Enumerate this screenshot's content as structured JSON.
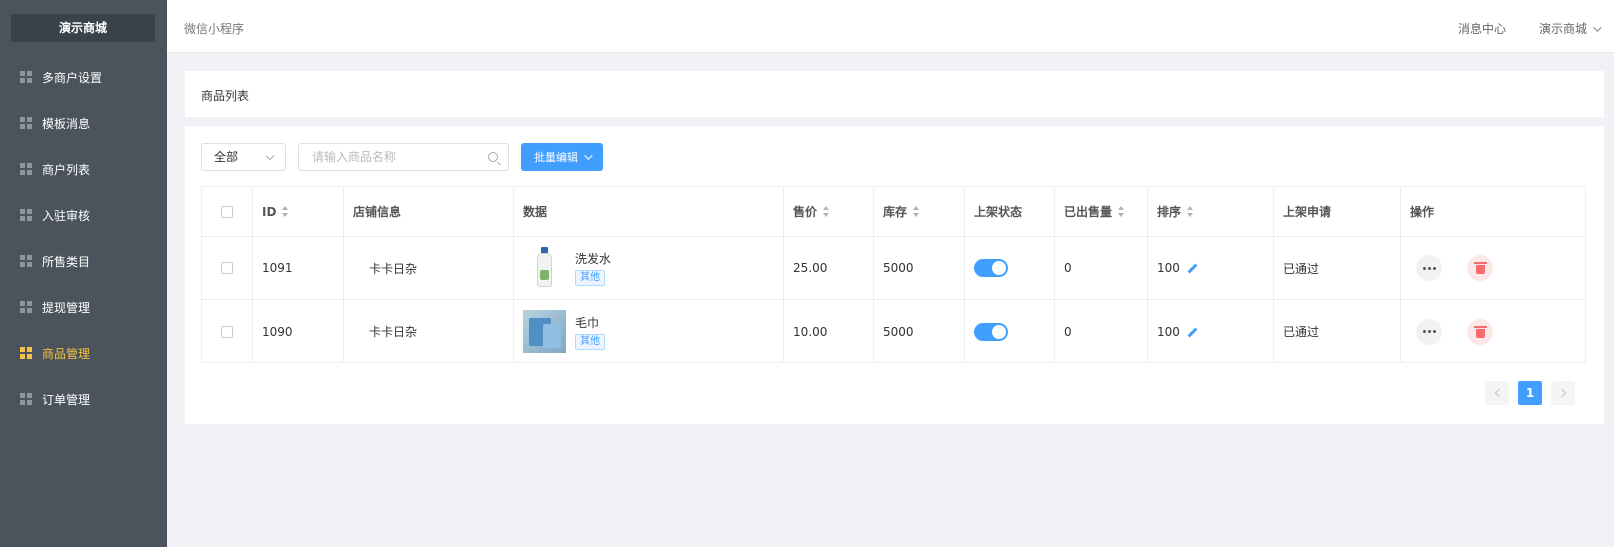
{
  "brand": "演示商城",
  "sidebar": {
    "items": [
      {
        "label": "多商户设置",
        "active": false
      },
      {
        "label": "模板消息",
        "active": false
      },
      {
        "label": "商户列表",
        "active": false
      },
      {
        "label": "入驻审核",
        "active": false
      },
      {
        "label": "所售类目",
        "active": false
      },
      {
        "label": "提现管理",
        "active": false
      },
      {
        "label": "商品管理",
        "active": true
      },
      {
        "label": "订单管理",
        "active": false
      }
    ],
    "active_color": "#f5c242"
  },
  "header": {
    "breadcrumb": "微信小程序",
    "message_center": "消息中心",
    "user": "演示商城"
  },
  "page_title": "商品列表",
  "filters": {
    "status_select": "全部",
    "search_placeholder": "请输入商品名称",
    "batch_edit": "批量编辑"
  },
  "table": {
    "columns": [
      "ID",
      "店铺信息",
      "数据",
      "售价",
      "库存",
      "上架状态",
      "已出售量",
      "排序",
      "上架申请",
      "操作"
    ],
    "rows": [
      {
        "id": "1091",
        "shop": "卡卡日杂",
        "product": "洗发水",
        "tag": "其他",
        "price": "25.00",
        "stock": "5000",
        "listed": true,
        "sold": "0",
        "sort": "100",
        "apply": "已通过",
        "thumb_icon": "shampoo-image"
      },
      {
        "id": "1090",
        "shop": "卡卡日杂",
        "product": "毛巾",
        "tag": "其他",
        "price": "10.00",
        "stock": "5000",
        "listed": true,
        "sold": "0",
        "sort": "100",
        "apply": "已通过",
        "thumb_icon": "towel-image"
      }
    ]
  },
  "pagination": {
    "current": "1"
  },
  "colors": {
    "primary": "#409eff",
    "sidebar_bg": "#4b545c",
    "danger": "#f56c6c"
  }
}
